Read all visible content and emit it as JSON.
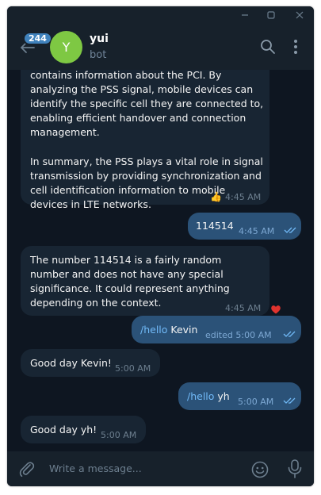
{
  "colors": {
    "background": "#0e1621",
    "header": "#17212b",
    "incoming_bubble": "#182533",
    "outgoing_bubble": "#2b5278",
    "accent": "#4082bc",
    "avatar": "#7ec843",
    "command": "#71baf8"
  },
  "titlebar": {
    "icons": [
      "minimize-icon",
      "maximize-icon",
      "close-icon"
    ]
  },
  "header": {
    "unread_badge": "244",
    "avatar_letter": "Y",
    "name": "yui",
    "status": "bot",
    "icons": [
      "back-arrow-icon",
      "search-icon",
      "more-vertical-icon"
    ]
  },
  "messages": [
    {
      "direction": "in",
      "text": "contains information about the PCI. By analyzing the PSS signal, mobile devices can identify the specific cell they are connected to, enabling efficient handover and connection management.\n\nIn summary, the PSS plays a vital role in signal transmission by providing synchronization and cell identification information to mobile devices in LTE networks.",
      "reaction": "👍",
      "time": "4:45 AM"
    },
    {
      "direction": "out",
      "text": "114514",
      "time": "4:45 AM",
      "status": "read"
    },
    {
      "direction": "in",
      "text": "The number 114514 is a fairly random number and does not have any special significance. It could represent anything depending on the context.",
      "time": "4:45 AM",
      "reaction": "❤️"
    },
    {
      "direction": "out",
      "command": "/hello",
      "text": " Kevin",
      "time": "edited 5:00 AM",
      "status": "read"
    },
    {
      "direction": "in",
      "text": "Good day Kevin!",
      "time": "5:00 AM"
    },
    {
      "direction": "out",
      "command": "/hello",
      "text": " yh",
      "time": "5:00 AM",
      "status": "read"
    },
    {
      "direction": "in",
      "text": "Good day yh!",
      "time": "5:00 AM"
    }
  ],
  "composer": {
    "placeholder": "Write a message...",
    "icons": [
      "paperclip-icon",
      "emoji-icon",
      "microphone-icon"
    ]
  }
}
